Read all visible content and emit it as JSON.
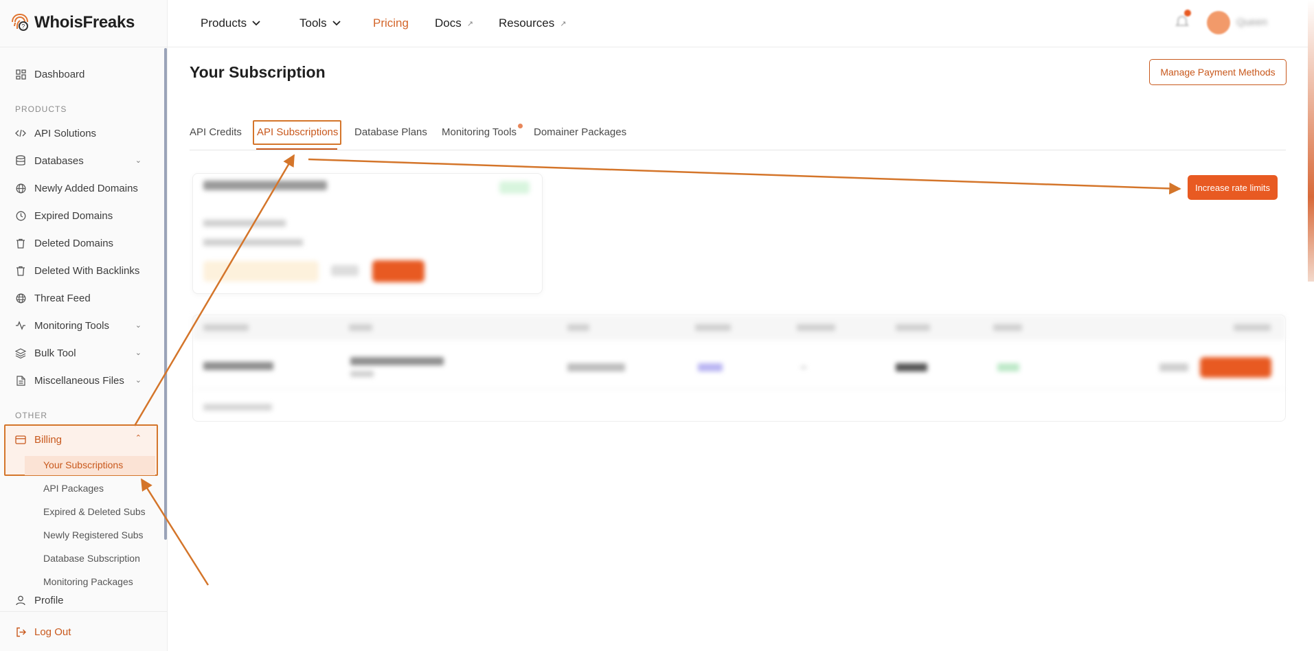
{
  "brand": {
    "name": "WhoisFreaks"
  },
  "topnav": {
    "items": [
      {
        "label": "Products"
      },
      {
        "label": "Tools"
      },
      {
        "label": "Pricing"
      },
      {
        "label": "Docs"
      },
      {
        "label": "Resources"
      }
    ],
    "user_name": "Queen"
  },
  "sidebar": {
    "dashboard": "Dashboard",
    "products_label": "PRODUCTS",
    "products": [
      {
        "label": "API Solutions"
      },
      {
        "label": "Databases"
      },
      {
        "label": "Newly Added Domains"
      },
      {
        "label": "Expired Domains"
      },
      {
        "label": "Deleted Domains"
      },
      {
        "label": "Deleted With Backlinks"
      },
      {
        "label": "Threat Feed"
      },
      {
        "label": "Monitoring Tools"
      },
      {
        "label": "Bulk Tool"
      },
      {
        "label": "Miscellaneous Files"
      }
    ],
    "other_label": "OTHER",
    "billing": "Billing",
    "billing_sub": [
      {
        "label": "Your Subscriptions"
      },
      {
        "label": "API Packages"
      },
      {
        "label": "Expired & Deleted Subs"
      },
      {
        "label": "Newly Registered Subs"
      },
      {
        "label": "Database Subscription"
      },
      {
        "label": "Monitoring Packages"
      }
    ],
    "profile": "Profile",
    "logout": "Log Out"
  },
  "main": {
    "title": "Your Subscription",
    "manage_payment": "Manage Payment Methods",
    "tabs": [
      {
        "label": "API Credits"
      },
      {
        "label": "API Subscriptions"
      },
      {
        "label": "Database Plans"
      },
      {
        "label": "Monitoring Tools"
      },
      {
        "label": "Domainer Packages"
      }
    ],
    "increase_rate_limits": "Increase rate limits"
  },
  "colors": {
    "accent": "#e85a22",
    "accent_text": "#c8581c",
    "annotation": "#d4752a"
  }
}
